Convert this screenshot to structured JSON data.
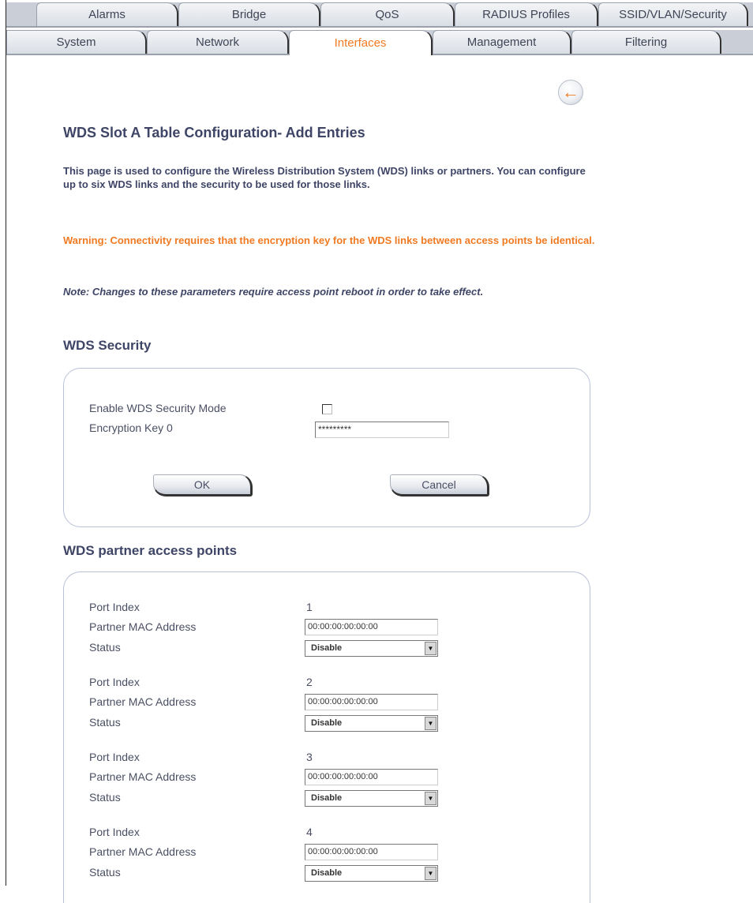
{
  "tabs_row1": [
    "Alarms",
    "Bridge",
    "QoS",
    "RADIUS Profiles",
    "SSID/VLAN/Security"
  ],
  "tabs_row2": [
    "System",
    "Network",
    "Interfaces",
    "Management",
    "Filtering"
  ],
  "active_tab": "Interfaces",
  "back_glyph": "←",
  "page_title": "WDS Slot A Table Configuration- Add Entries",
  "intro": "This page is used to configure the Wireless Distribution System (WDS) links or partners. You can configure up to six WDS links and the security to be used for those links.",
  "warning": "Warning: Connectivity requires that the encryption key for the WDS links between access points be identical.",
  "note": "Note: Changes to these parameters require access point reboot in order to take effect.",
  "security": {
    "heading": "WDS Security",
    "enable_label": "Enable WDS Security Mode",
    "key_label": "Encryption Key 0",
    "key_value": "*********",
    "ok_label": "OK",
    "cancel_label": "Cancel"
  },
  "partners": {
    "heading": "WDS partner access points",
    "port_label": "Port Index",
    "mac_label": "Partner MAC Address",
    "status_label": "Status",
    "entries": [
      {
        "index": "1",
        "mac": "00:00:00:00:00:00",
        "status": "Disable"
      },
      {
        "index": "2",
        "mac": "00:00:00:00:00:00",
        "status": "Disable"
      },
      {
        "index": "3",
        "mac": "00:00:00:00:00:00",
        "status": "Disable"
      },
      {
        "index": "4",
        "mac": "00:00:00:00:00:00",
        "status": "Disable"
      }
    ]
  },
  "colors": {
    "accent": "#f07a22",
    "heading": "#3e4566",
    "panel_border": "#b9c2d6"
  }
}
